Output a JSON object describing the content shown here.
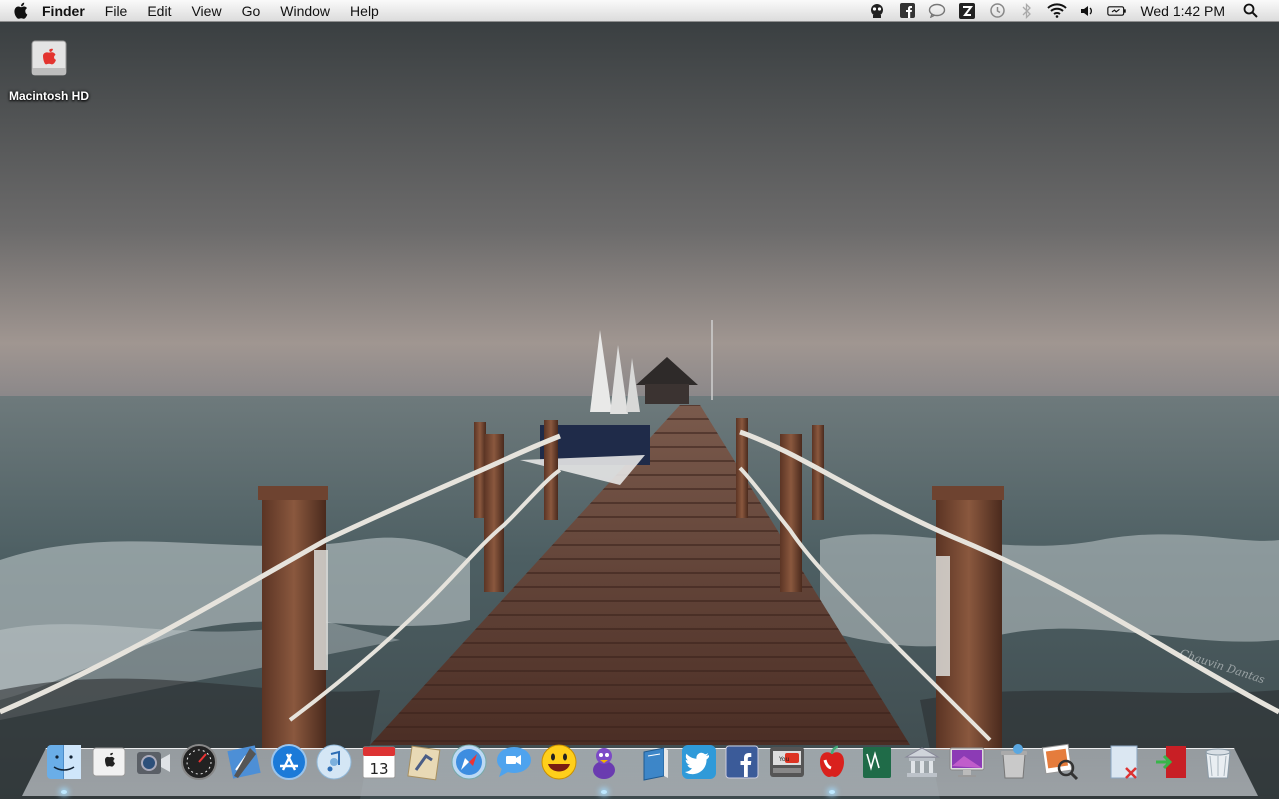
{
  "menubar": {
    "app_name": "Finder",
    "menus": [
      "File",
      "Edit",
      "View",
      "Go",
      "Window",
      "Help"
    ],
    "clock": "Wed 1:42 PM",
    "status_icons": [
      "robot-icon",
      "facebook-icon",
      "chat-bubble-icon",
      "dropzone-icon",
      "time-machine-icon",
      "bluetooth-icon",
      "wifi-icon",
      "volume-icon",
      "battery-icon"
    ],
    "calendar_badge_date": "13"
  },
  "desktop": {
    "icons": [
      {
        "label": "Macintosh HD",
        "icon": "hard-drive-icon"
      }
    ]
  },
  "dock": {
    "items": [
      {
        "name": "Finder",
        "icon": "finder-icon",
        "running": true
      },
      {
        "name": "System Info",
        "icon": "mac-info-icon",
        "running": false
      },
      {
        "name": "FaceTime",
        "icon": "facetime-icon",
        "running": false
      },
      {
        "name": "Dashboard",
        "icon": "dashboard-icon",
        "running": false
      },
      {
        "name": "Xcode",
        "icon": "xcode-icon",
        "running": false
      },
      {
        "name": "App Store",
        "icon": "app-store-icon",
        "running": false
      },
      {
        "name": "iTunes",
        "icon": "itunes-icon",
        "running": false
      },
      {
        "name": "Calendar",
        "icon": "calendar-icon",
        "running": false
      },
      {
        "name": "Mail",
        "icon": "mail-icon",
        "running": false
      },
      {
        "name": "Safari",
        "icon": "safari-icon",
        "running": false
      },
      {
        "name": "Messages",
        "icon": "messages-icon",
        "running": false
      },
      {
        "name": "Yahoo Messenger",
        "icon": "smiley-icon",
        "running": false
      },
      {
        "name": "Adium",
        "icon": "duck-icon",
        "running": true
      },
      {
        "name": "iBooks",
        "icon": "book-icon",
        "running": false
      },
      {
        "name": "Twitter",
        "icon": "twitter-icon",
        "running": false
      },
      {
        "name": "Facebook",
        "icon": "facebook-app-icon",
        "running": false
      },
      {
        "name": "YouTube",
        "icon": "youtube-icon",
        "running": false
      },
      {
        "name": "Apple Quiz",
        "icon": "apple-icon",
        "running": true
      },
      {
        "name": "Notes",
        "icon": "notebook-icon",
        "running": false
      },
      {
        "name": "Bank",
        "icon": "bank-icon",
        "running": false
      },
      {
        "name": "Display",
        "icon": "imac-icon",
        "running": false
      },
      {
        "name": "Cleaner",
        "icon": "trash-cleaner-icon",
        "running": false
      },
      {
        "name": "Preview",
        "icon": "preview-icon",
        "running": false
      },
      {
        "name": "Documents",
        "icon": "documents-icon",
        "running": false
      },
      {
        "name": "Exit",
        "icon": "exit-door-icon",
        "running": false
      },
      {
        "name": "Trash",
        "icon": "trash-icon",
        "running": false
      }
    ]
  },
  "wallpaper": {
    "signature": "Chauvin Dantas",
    "colors": {
      "sky_top": "#3d4244",
      "horizon": "#9a928e",
      "sea": "#5b6a6e",
      "deck": "#5a3d33"
    }
  }
}
